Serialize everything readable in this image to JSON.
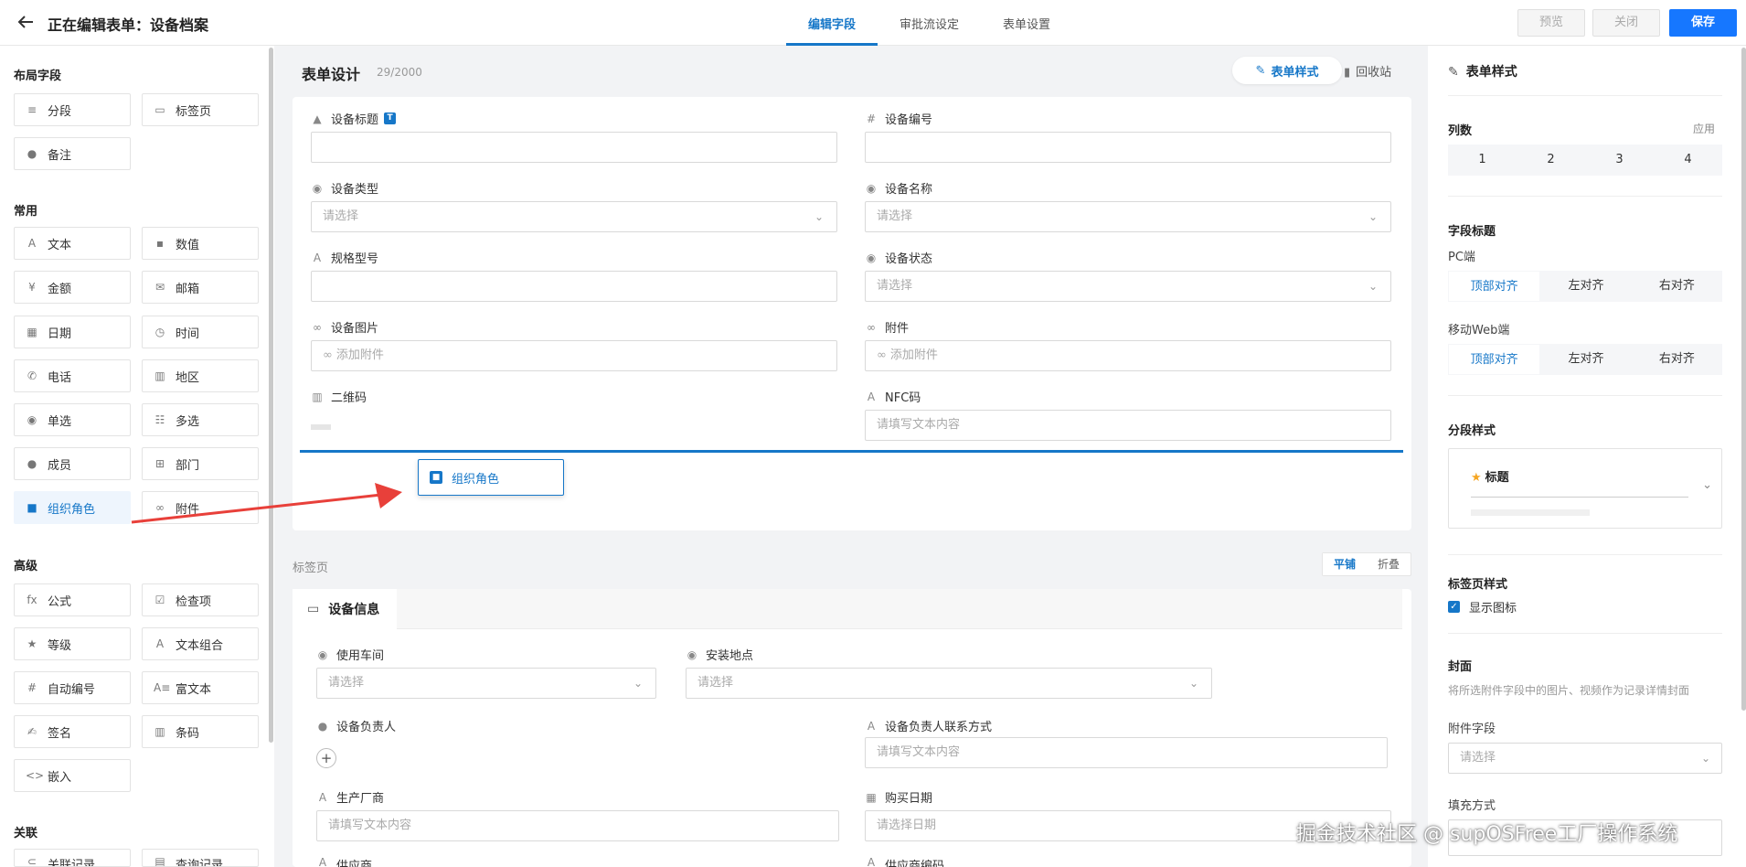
{
  "header": {
    "title": "正在编辑表单：设备档案",
    "tabs": [
      {
        "label": "编辑字段"
      },
      {
        "label": "审批流设定"
      },
      {
        "label": "表单设置"
      }
    ],
    "buttons": {
      "preview": "预览",
      "close": "关闭",
      "save": "保存"
    }
  },
  "left": {
    "groups": [
      {
        "title": "布局字段"
      },
      {
        "title": "常用"
      },
      {
        "title": "高级"
      },
      {
        "title": "关联"
      }
    ],
    "layout_items": [
      "分段",
      "标签页",
      "备注"
    ],
    "common_items": [
      "文本",
      "数值",
      "金额",
      "邮箱",
      "日期",
      "时间",
      "电话",
      "地区",
      "单选",
      "多选",
      "成员",
      "部门",
      "组织角色",
      "附件"
    ],
    "advanced_items": [
      "公式",
      "检查项",
      "等级",
      "文本组合",
      "自动编号",
      "富文本",
      "签名",
      "条码",
      "嵌入"
    ],
    "relation_items": [
      "关联记录",
      "查询记录"
    ]
  },
  "center": {
    "title": "表单设计",
    "count": "29/2000",
    "style_button": "表单样式",
    "recycle": "回收站",
    "fields": [
      {
        "label": "设备标题",
        "badge": "T"
      },
      {
        "label": "设备编号"
      },
      {
        "label": "设备类型",
        "placeholder": "请选择"
      },
      {
        "label": "设备名称",
        "placeholder": "请选择"
      },
      {
        "label": "规格型号"
      },
      {
        "label": "设备状态",
        "placeholder": "请选择"
      },
      {
        "label": "设备图片",
        "placeholder": "添加附件"
      },
      {
        "label": "附件",
        "placeholder": "添加附件"
      },
      {
        "label": "二维码"
      },
      {
        "label": "NFC码",
        "placeholder": "请填写文本内容"
      }
    ],
    "drag_ghost": "组织角色",
    "tab_section": {
      "label": "标签页",
      "modes": [
        "平铺",
        "折叠"
      ],
      "tab": "设备信息",
      "fields": [
        {
          "label": "使用车间",
          "placeholder": "请选择"
        },
        {
          "label": "安装地点",
          "placeholder": "请选择"
        },
        {
          "label": "设备负责人"
        },
        {
          "label": "设备负责人联系方式",
          "placeholder": "请填写文本内容"
        },
        {
          "label": "生产厂商",
          "placeholder": "请填写文本内容"
        },
        {
          "label": "购买日期",
          "placeholder": "请选择日期"
        },
        {
          "label": "供应商"
        },
        {
          "label": "供应商编码"
        }
      ]
    }
  },
  "right": {
    "title": "表单样式",
    "columns_label": "列数",
    "apply": "应用",
    "columns": [
      "1",
      "2",
      "3",
      "4"
    ],
    "field_title": "字段标题",
    "pc": "PC端",
    "mobile": "移动Web端",
    "align": [
      "顶部对齐",
      "左对齐",
      "右对齐"
    ],
    "section_style": "分段样式",
    "section_preview": "标题",
    "tab_style": "标签页样式",
    "show_icon": "显示图标",
    "cover": "封面",
    "cover_desc": "将所选附件字段中的图片、视频作为记录详情封面",
    "attach_field": "附件字段",
    "attach_placeholder": "请选择",
    "fill_mode": "填充方式"
  },
  "watermark": "掘金技术社区 @ supOSFree工厂操作系统",
  "colors": {
    "accent": "#1677c8",
    "primary_button": "#1677ff",
    "arrow": "#e8403a"
  }
}
